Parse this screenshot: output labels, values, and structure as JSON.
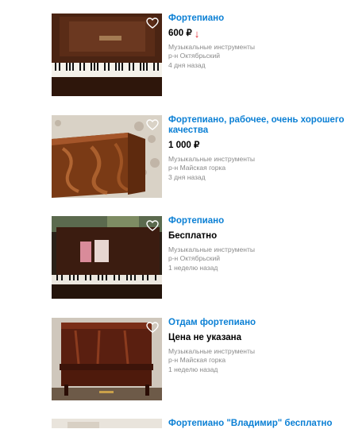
{
  "listings": [
    {
      "title": "Фортепиано",
      "price": "600 ₽",
      "price_trend": "↓",
      "category": "Музыкальные инструменты",
      "location": "р-н Октябрьский",
      "date": "4 дня назад"
    },
    {
      "title": "Фортепиано, рабочее, очень хорошего качества",
      "price": "1 000 ₽",
      "category": "Музыкальные инструменты",
      "location": "р-н Майская горка",
      "date": "3 дня назад"
    },
    {
      "title": "Фортепиано",
      "price": "Бесплатно",
      "category": "Музыкальные инструменты",
      "location": "р-н Октябрьский",
      "date": "1 неделю назад"
    },
    {
      "title": "Отдам фортепиано",
      "price": "Цена не указана",
      "category": "Музыкальные инструменты",
      "location": "р-н Майская горка",
      "date": "1 неделю назад"
    },
    {
      "title": "Фортепиано \"Владимир\" бесплатно"
    }
  ],
  "icons": {
    "favorite": "heart-outline-icon",
    "price_drop": "arrow-down-icon"
  },
  "colors": {
    "title": "#0a7fd4",
    "price_drop": "#e0232b",
    "meta": "#8a8a8a"
  }
}
